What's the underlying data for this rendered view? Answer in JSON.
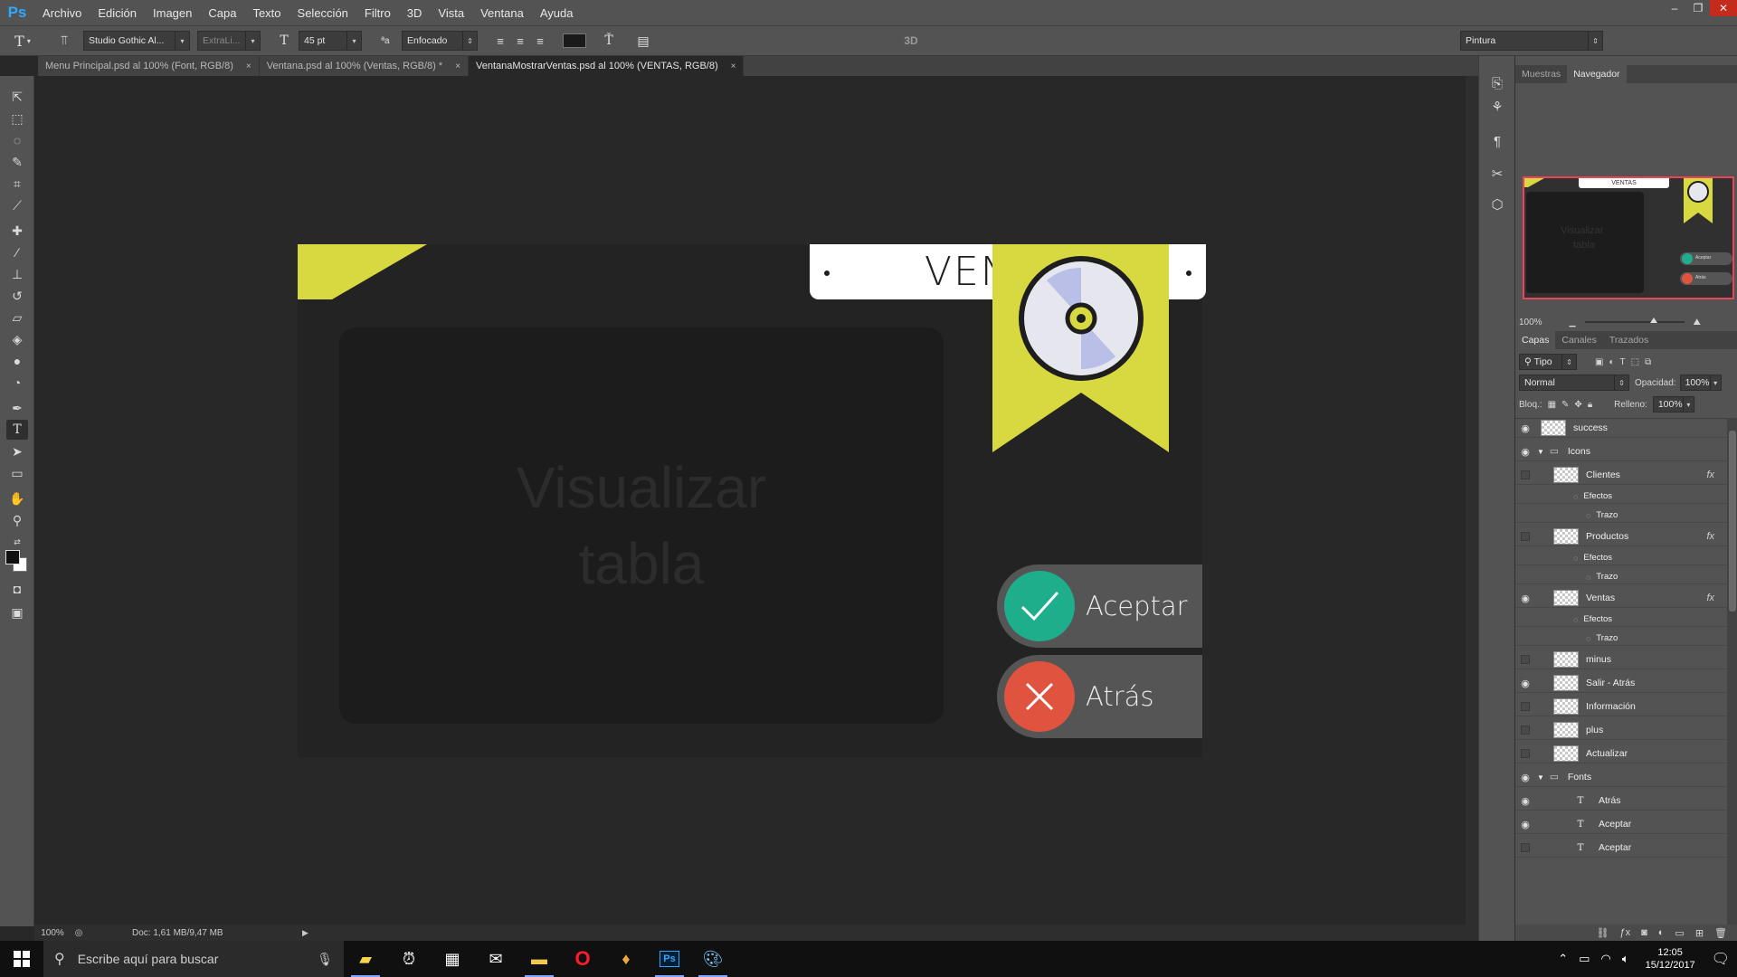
{
  "app": {
    "logo": "Ps"
  },
  "menu": [
    "Archivo",
    "Edición",
    "Imagen",
    "Capa",
    "Texto",
    "Selección",
    "Filtro",
    "3D",
    "Vista",
    "Ventana",
    "Ayuda"
  ],
  "window_controls": {
    "minimize": "–",
    "restore": "❐",
    "close": "✕"
  },
  "options": {
    "font_family": "Studio Gothic Al...",
    "font_style": "ExtraLi...",
    "font_size": "45 pt",
    "aa_label": "ªa",
    "antialias": "Enfocado",
    "mode_3d": "3D",
    "workspace": "Pintura"
  },
  "tabs": [
    {
      "label": "Menu Principal.psd al 100% (Font, RGB/8)",
      "active": false
    },
    {
      "label": "Ventana.psd al 100% (Ventas, RGB/8) *",
      "active": false
    },
    {
      "label": "VentanaMostrarVentas.psd al 100% (VENTAS, RGB/8)",
      "active": true
    }
  ],
  "tab_close": "×",
  "design": {
    "title": "VENTAS",
    "placeholder_line1": "Visualizar",
    "placeholder_line2": "tabla",
    "accept_label": "Aceptar",
    "back_label": "Atrás",
    "colors": {
      "accent_yellow": "#d8d840",
      "accept_green": "#1fae8c",
      "back_red": "#e0533f",
      "background": "#232323"
    }
  },
  "status": {
    "zoom": "100%",
    "doc": "Doc: 1,61 MB/9,47 MB"
  },
  "panel_tabs_top": [
    "Muestras",
    "Navegador"
  ],
  "navigator": {
    "zoom": "100%",
    "mini_title": "VENTAS",
    "mini_placeholder_1": "Visualizar",
    "mini_placeholder_2": "tabla",
    "mini_accept": "Aceptar",
    "mini_back": "Atrás"
  },
  "panel_tabs_layers": [
    "Capas",
    "Canales",
    "Trazados"
  ],
  "layers_panel": {
    "filter": "Tipo",
    "blend_mode": "Normal",
    "opacity_label": "Opacidad:",
    "opacity": "100%",
    "lock_label": "Bloq.:",
    "fill_label": "Relleno:",
    "fill": "100%"
  },
  "layers": [
    {
      "name": "success",
      "kind": "image",
      "visible": true,
      "indent": 0
    },
    {
      "name": "Icons",
      "kind": "group",
      "visible": true,
      "indent": 0
    },
    {
      "name": "Clientes",
      "kind": "image",
      "visible": false,
      "indent": 1,
      "fx": true
    },
    {
      "name": "Efectos",
      "kind": "effect",
      "visible": false,
      "indent": 2
    },
    {
      "name": "Trazo",
      "kind": "effect",
      "visible": false,
      "indent": 3
    },
    {
      "name": "Productos",
      "kind": "image",
      "visible": false,
      "indent": 1,
      "fx": true
    },
    {
      "name": "Efectos",
      "kind": "effect",
      "visible": false,
      "indent": 2
    },
    {
      "name": "Trazo",
      "kind": "effect",
      "visible": false,
      "indent": 3
    },
    {
      "name": "Ventas",
      "kind": "image",
      "visible": true,
      "indent": 1,
      "fx": true
    },
    {
      "name": "Efectos",
      "kind": "effect",
      "visible": false,
      "indent": 2
    },
    {
      "name": "Trazo",
      "kind": "effect",
      "visible": false,
      "indent": 3
    },
    {
      "name": "minus",
      "kind": "image",
      "visible": false,
      "indent": 1
    },
    {
      "name": "Salir - Atrás",
      "kind": "image",
      "visible": true,
      "indent": 1
    },
    {
      "name": "Información",
      "kind": "image",
      "visible": false,
      "indent": 1
    },
    {
      "name": "plus",
      "kind": "image",
      "visible": false,
      "indent": 1
    },
    {
      "name": "Actualizar",
      "kind": "image",
      "visible": false,
      "indent": 1
    },
    {
      "name": "Fonts",
      "kind": "group",
      "visible": true,
      "indent": 0
    },
    {
      "name": "Atrás",
      "kind": "text",
      "visible": true,
      "indent": 1
    },
    {
      "name": "Aceptar",
      "kind": "text",
      "visible": true,
      "indent": 1
    },
    {
      "name": "Aceptar",
      "kind": "text",
      "visible": false,
      "indent": 1
    }
  ],
  "layer_fx_label": "fx",
  "taskbar": {
    "search_placeholder": "Escribe aquí para buscar",
    "time": "12:05",
    "date": "15/12/2017"
  }
}
